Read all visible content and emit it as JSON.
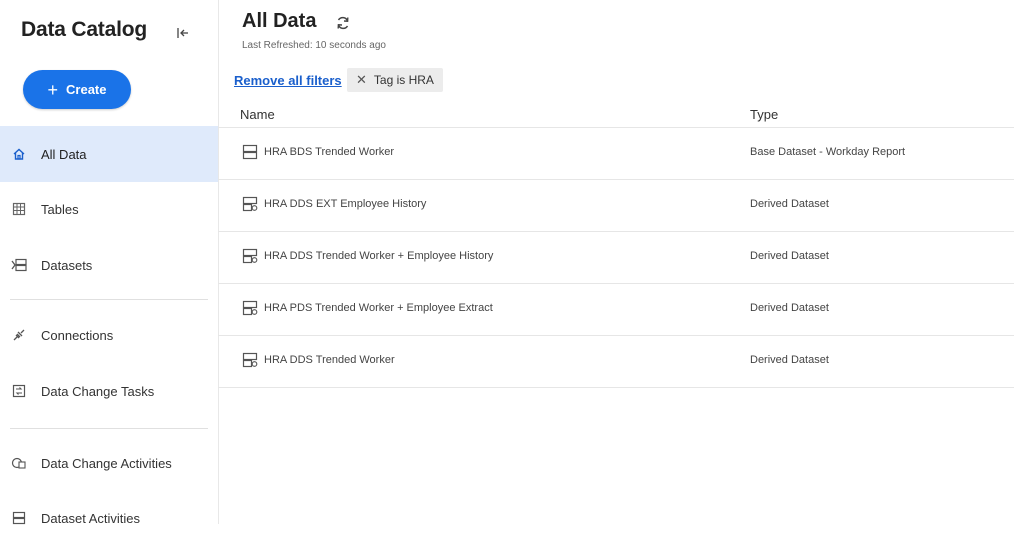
{
  "sidebar": {
    "title": "Data Catalog",
    "create_label": "Create",
    "items": [
      {
        "label": "All Data",
        "icon": "home-icon"
      },
      {
        "label": "Tables",
        "icon": "table-icon"
      },
      {
        "label": "Datasets",
        "icon": "datasets-icon"
      },
      {
        "label": "Connections",
        "icon": "plug-icon"
      },
      {
        "label": "Data Change Tasks",
        "icon": "task-icon"
      },
      {
        "label": "Data Change Activities",
        "icon": "activities-icon"
      },
      {
        "label": "Dataset Activities",
        "icon": "dataset-activities-icon"
      }
    ]
  },
  "main": {
    "title": "All Data",
    "last_refreshed": "Last Refreshed: 10 seconds ago",
    "remove_filters": "Remove all filters",
    "filter_chip": "Tag is HRA",
    "columns": {
      "name": "Name",
      "type": "Type"
    },
    "rows": [
      {
        "name": "HRA BDS Trended Worker",
        "type": "Base Dataset - Workday Report"
      },
      {
        "name": "HRA DDS EXT Employee History",
        "type": "Derived Dataset"
      },
      {
        "name": "HRA DDS Trended Worker + Employee History",
        "type": "Derived Dataset"
      },
      {
        "name": "HRA PDS Trended Worker + Employee Extract",
        "type": "Derived Dataset"
      },
      {
        "name": "HRA DDS Trended Worker",
        "type": "Derived Dataset"
      }
    ]
  },
  "colors": {
    "accent": "#1a73e8",
    "active_nav": "#dfeafb",
    "link": "#1a5fcc"
  }
}
